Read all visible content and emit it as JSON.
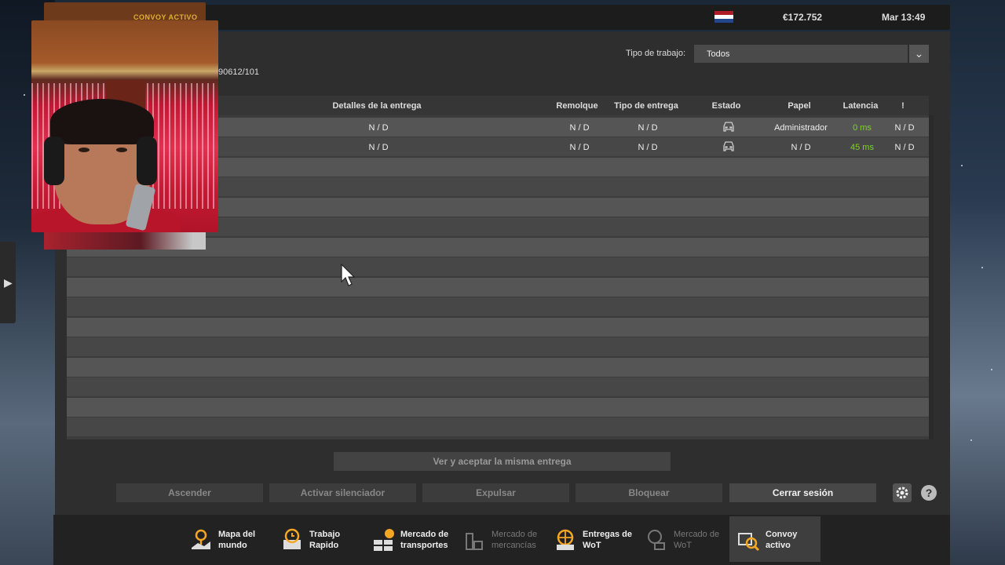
{
  "header": {
    "breadcrumb": "CONVOY ACTIVO",
    "money": "€172.752",
    "clock": "Mar 13:49",
    "flag_colors": [
      "#ae1c28",
      "#ffffff",
      "#21468b"
    ]
  },
  "filter": {
    "label": "Tipo de trabajo:",
    "selected": "Todos"
  },
  "session_id": "90612/101",
  "table": {
    "columns": [
      "Detalles de la entrega",
      "Remolque",
      "Tipo de entrega",
      "Estado",
      "Papel",
      "Latencia",
      "!"
    ],
    "rows": [
      {
        "details": "N / D",
        "trailer": "N / D",
        "delivery_type": "N / D",
        "status": "car-icon",
        "role": "Administrador",
        "latency": "0 ms",
        "flag": "N / D"
      },
      {
        "details": "N / D",
        "trailer": "N / D",
        "delivery_type": "N / D",
        "status": "car-icon",
        "role": "N / D",
        "latency": "45 ms",
        "flag": "N / D"
      }
    ]
  },
  "actions": {
    "same_delivery": "Ver y aceptar la misma entrega",
    "promote": "Ascender",
    "mute": "Activar silenciador",
    "kick": "Expulsar",
    "block": "Bloquear",
    "logout": "Cerrar sesión",
    "help": "?"
  },
  "bottom_nav": [
    {
      "label": "Mapa del mundo",
      "icon": "map-icon"
    },
    {
      "label": "Trabajo Rapido",
      "icon": "clock-icon"
    },
    {
      "label": "Mercado de transportes",
      "icon": "cargo-market-icon"
    },
    {
      "label": "Mercado de mercancías",
      "icon": "freight-market-icon"
    },
    {
      "label": "Entregas de WoT",
      "icon": "globe-icon"
    },
    {
      "label": "Mercado de WoT",
      "icon": "globe-market-icon"
    },
    {
      "label": "Convoy activo",
      "icon": "convoy-icon"
    }
  ],
  "colors": {
    "accent_orange": "#e0b030",
    "latency_green": "#7ed321",
    "panel": "#2e2e2e"
  }
}
